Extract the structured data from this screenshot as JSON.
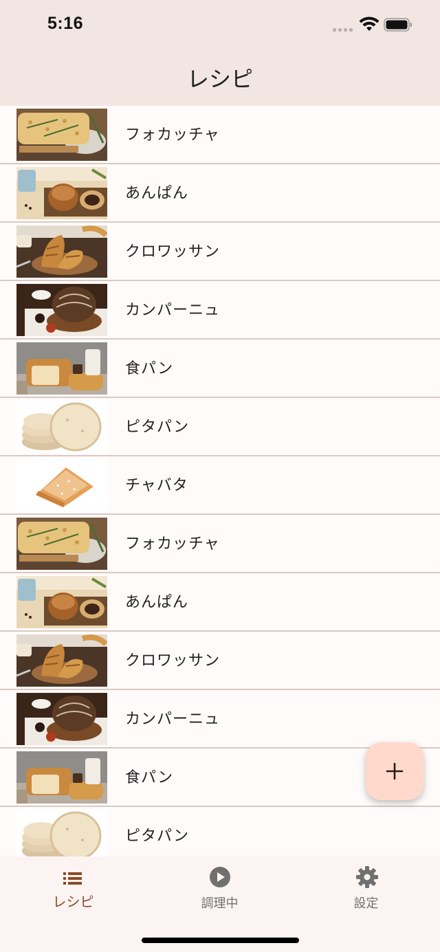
{
  "status_bar": {
    "time": "5:16"
  },
  "nav": {
    "title": "レシピ"
  },
  "recipes": [
    {
      "name": "フォカッチャ",
      "image": "focaccia"
    },
    {
      "name": "あんぱん",
      "image": "anpan"
    },
    {
      "name": "クロワッサン",
      "image": "croissant"
    },
    {
      "name": "カンパーニュ",
      "image": "campagne"
    },
    {
      "name": "食パン",
      "image": "shokupan"
    },
    {
      "name": "ピタパン",
      "image": "pita"
    },
    {
      "name": "チャバタ",
      "image": "ciabatta"
    },
    {
      "name": "フォカッチャ",
      "image": "focaccia"
    },
    {
      "name": "あんぱん",
      "image": "anpan"
    },
    {
      "name": "クロワッサン",
      "image": "croissant"
    },
    {
      "name": "カンパーニュ",
      "image": "campagne"
    },
    {
      "name": "食パン",
      "image": "shokupan"
    },
    {
      "name": "ピタパン",
      "image": "pita"
    }
  ],
  "fab": {
    "icon": "plus-icon"
  },
  "tabs": [
    {
      "label": "レシピ",
      "icon": "list-icon",
      "selected": true
    },
    {
      "label": "調理中",
      "icon": "play-circle-icon",
      "selected": false
    },
    {
      "label": "設定",
      "icon": "gear-icon",
      "selected": false
    }
  ],
  "colors": {
    "header_bg": "#f2e6e2",
    "accent": "#8b4a26",
    "inactive": "#707070",
    "fab_bg": "#ffdacc",
    "separator": "#dbc8c1"
  }
}
